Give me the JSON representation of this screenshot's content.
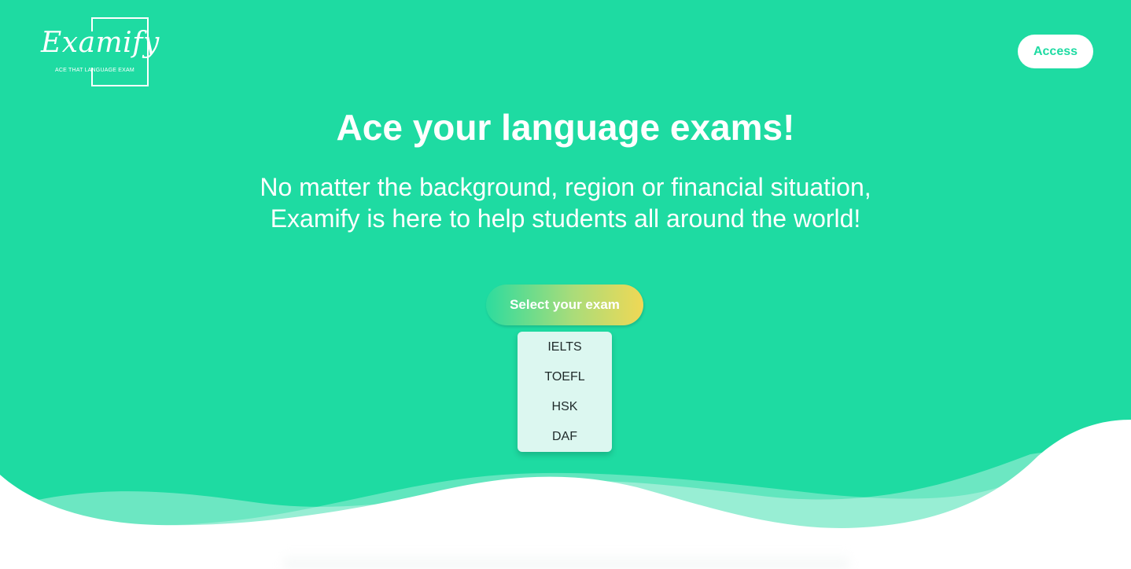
{
  "brand": {
    "name": "Examify",
    "tagline": "ACE THAT LANGUAGE EXAM"
  },
  "header": {
    "access_label": "Access"
  },
  "hero": {
    "title": "Ace your language exams!",
    "subtitle_line1": "No matter the background, region or financial situation,",
    "subtitle_line2": "Examify is here to help students all around the world!",
    "select_label": "Select your exam"
  },
  "exam_menu": {
    "items": [
      {
        "label": "IELTS"
      },
      {
        "label": "TOEFL"
      },
      {
        "label": "HSK"
      },
      {
        "label": "DAF"
      }
    ]
  },
  "colors": {
    "brand_green": "#1edba2",
    "menu_background": "#dcf7f0",
    "gradient_end": "#f0d855"
  }
}
